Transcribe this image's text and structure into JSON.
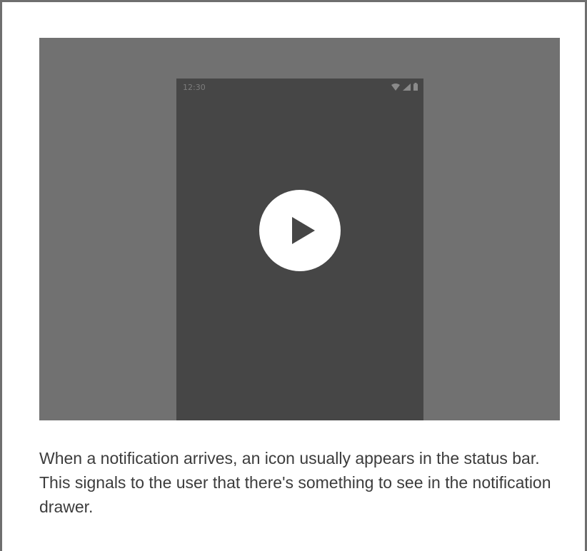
{
  "video": {
    "status_bar": {
      "time": "12:30",
      "icons": [
        "wifi-icon",
        "signal-icon",
        "battery-icon"
      ]
    },
    "play_icon": "play-icon"
  },
  "caption": {
    "text": "When a notification arrives, an icon usually appears in the status bar. This signals to the user that there's something to see in the notification drawer."
  },
  "colors": {
    "stage_background": "#717171",
    "phone_screen": "#464646",
    "play_button": "#ffffff",
    "caption_text": "#3c3c3c",
    "frame_border": "#6f6f6f"
  }
}
